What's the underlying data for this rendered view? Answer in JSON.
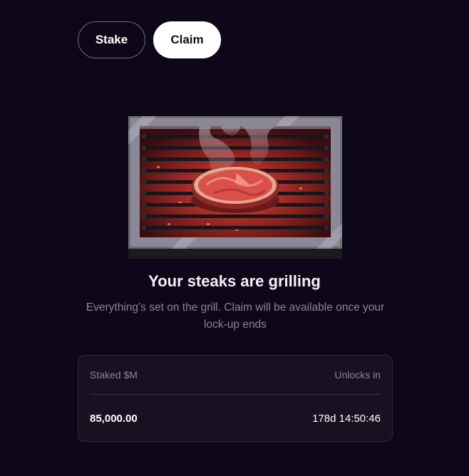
{
  "tabs": {
    "stake_label": "Stake",
    "claim_label": "Claim",
    "active": "Claim"
  },
  "illustration": {
    "name": "steak-on-grill-illustration",
    "colors": {
      "frame": "#7b7a86",
      "grate": "#1a1a1e",
      "embers": "#c0302a",
      "steak": "#d94f4a",
      "smoke": "#d9d3da"
    }
  },
  "status": {
    "title": "Your steaks are grilling",
    "description": "Everything’s set on the grill. Claim will be available once your lock-up ends"
  },
  "summary": {
    "staked_label": "Staked $M",
    "unlocks_label": "Unlocks in",
    "staked_value": "85,000.00",
    "unlocks_value": "178d 14:50:46"
  },
  "colors": {
    "background": "#0e0719",
    "card": "#171122",
    "muted_text": "#8a8694"
  }
}
